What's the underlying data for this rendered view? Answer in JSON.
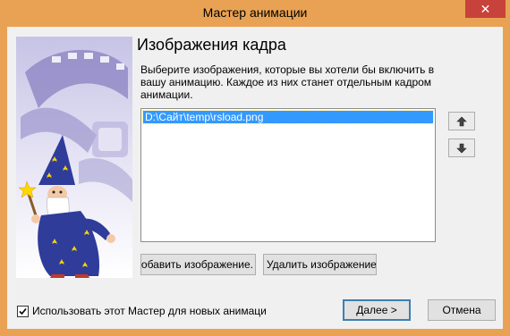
{
  "window": {
    "title": "Мастер анимации",
    "close_glyph": "✕",
    "frame_color": "#e9a253",
    "close_color": "#c7423a"
  },
  "page": {
    "heading": "Изображения кадра",
    "description": "Выберите изображения, которые вы хотели бы включить в вашу анимацию. Каждое из них станет отдельным кадром анимации."
  },
  "image_list": {
    "items": [
      {
        "path": "D:\\Сайт\\temp\\rsload.png",
        "selected": true
      }
    ],
    "move_up_icon": "arrow-up-icon",
    "move_down_icon": "arrow-down-icon"
  },
  "buttons": {
    "add_image": "обавить изображение.",
    "remove_image": "Удалить изображение",
    "next": "Далее >",
    "cancel": "Отмена"
  },
  "options": {
    "use_wizard_label": "Использовать этот Мастер для новых анимаци",
    "use_wizard_checked": true
  },
  "illustration": {
    "icon": "wizard-with-film-strip"
  }
}
